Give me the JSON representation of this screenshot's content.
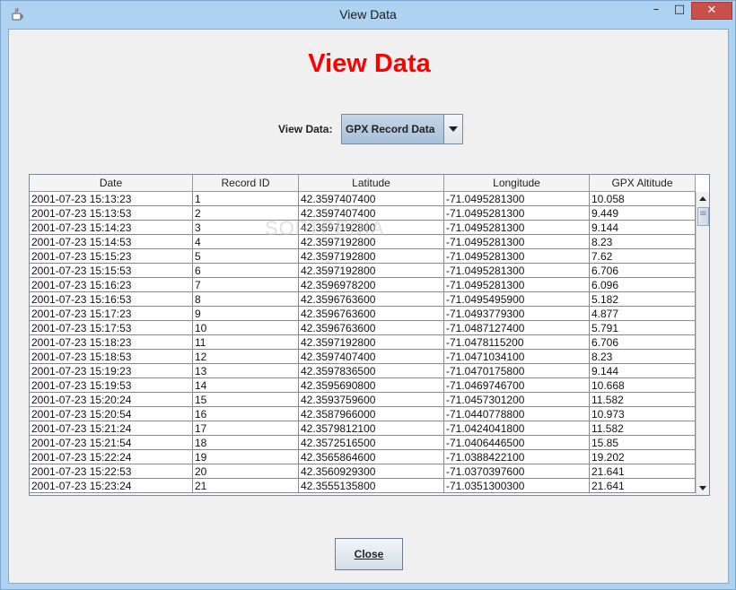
{
  "window": {
    "title": "View Data",
    "icon": "java-cup-icon",
    "controls": {
      "minimize": "–",
      "maximize": "□",
      "close": "✕"
    }
  },
  "heading": "View Data",
  "heading_color": "#ff0000",
  "selector": {
    "label": "View Data:",
    "selected": "GPX Record Data"
  },
  "watermark": "SOFTPEDIA",
  "table": {
    "columns": [
      "Date",
      "Record ID",
      "Latitude",
      "Longitude",
      "GPX Altitude"
    ],
    "rows": [
      [
        "2001-07-23 15:13:23",
        "1",
        "42.3597407400",
        "-71.0495281300",
        "10.058"
      ],
      [
        "2001-07-23 15:13:53",
        "2",
        "42.3597407400",
        "-71.0495281300",
        "9.449"
      ],
      [
        "2001-07-23 15:14:23",
        "3",
        "42.3597192800",
        "-71.0495281300",
        "9.144"
      ],
      [
        "2001-07-23 15:14:53",
        "4",
        "42.3597192800",
        "-71.0495281300",
        "8.23"
      ],
      [
        "2001-07-23 15:15:23",
        "5",
        "42.3597192800",
        "-71.0495281300",
        "7.62"
      ],
      [
        "2001-07-23 15:15:53",
        "6",
        "42.3597192800",
        "-71.0495281300",
        "6.706"
      ],
      [
        "2001-07-23 15:16:23",
        "7",
        "42.3596978200",
        "-71.0495281300",
        "6.096"
      ],
      [
        "2001-07-23 15:16:53",
        "8",
        "42.3596763600",
        "-71.0495495900",
        "5.182"
      ],
      [
        "2001-07-23 15:17:23",
        "9",
        "42.3596763600",
        "-71.0493779300",
        "4.877"
      ],
      [
        "2001-07-23 15:17:53",
        "10",
        "42.3596763600",
        "-71.0487127400",
        "5.791"
      ],
      [
        "2001-07-23 15:18:23",
        "11",
        "42.3597192800",
        "-71.0478115200",
        "6.706"
      ],
      [
        "2001-07-23 15:18:53",
        "12",
        "42.3597407400",
        "-71.0471034100",
        "8.23"
      ],
      [
        "2001-07-23 15:19:23",
        "13",
        "42.3597836500",
        "-71.0470175800",
        "9.144"
      ],
      [
        "2001-07-23 15:19:53",
        "14",
        "42.3595690800",
        "-71.0469746700",
        "10.668"
      ],
      [
        "2001-07-23 15:20:24",
        "15",
        "42.3593759600",
        "-71.0457301200",
        "11.582"
      ],
      [
        "2001-07-23 15:20:54",
        "16",
        "42.3587966000",
        "-71.0440778800",
        "10.973"
      ],
      [
        "2001-07-23 15:21:24",
        "17",
        "42.3579812100",
        "-71.0424041800",
        "11.582"
      ],
      [
        "2001-07-23 15:21:54",
        "18",
        "42.3572516500",
        "-71.0406446500",
        "15.85"
      ],
      [
        "2001-07-23 15:22:24",
        "19",
        "42.3565864600",
        "-71.0388422100",
        "19.202"
      ],
      [
        "2001-07-23 15:22:53",
        "20",
        "42.3560929300",
        "-71.0370397600",
        "21.641"
      ],
      [
        "2001-07-23 15:23:24",
        "21",
        "42.3555135800",
        "-71.0351300300",
        "21.641"
      ]
    ]
  },
  "close_button": {
    "label": "Close"
  }
}
